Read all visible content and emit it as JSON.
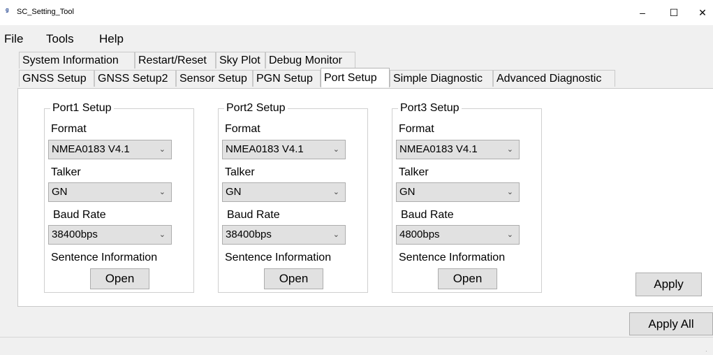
{
  "window": {
    "title": "SC_Setting_Tool",
    "min": "–",
    "max": "☐",
    "close": "✕"
  },
  "menu": [
    "File",
    "Tools",
    "Help"
  ],
  "tabs_row1": [
    "System Information",
    "Restart/Reset",
    "Sky Plot",
    "Debug Monitor"
  ],
  "tabs_row2": [
    "GNSS Setup",
    "GNSS Setup2",
    "Sensor Setup",
    "PGN Setup",
    "Port Setup",
    "Simple Diagnostic",
    "Advanced Diagnostic"
  ],
  "ports": [
    {
      "title": "Port1 Setup",
      "format_label": "Format",
      "format": "NMEA0183 V4.1",
      "talker_label": "Talker",
      "talker": "GN",
      "baud_label": "Baud Rate",
      "baud": "38400bps",
      "sentence_label": "Sentence Information",
      "open": "Open"
    },
    {
      "title": "Port2 Setup",
      "format_label": "Format",
      "format": "NMEA0183 V4.1",
      "talker_label": "Talker",
      "talker": "GN",
      "baud_label": "Baud Rate",
      "baud": "38400bps",
      "sentence_label": "Sentence Information",
      "open": "Open"
    },
    {
      "title": "Port3 Setup",
      "format_label": "Format",
      "format": "NMEA0183 V4.1",
      "talker_label": "Talker",
      "talker": "GN",
      "baud_label": "Baud Rate",
      "baud": "4800bps",
      "sentence_label": "Sentence Information",
      "open": "Open"
    }
  ],
  "apply": "Apply",
  "apply_all": "Apply All",
  "icons": {
    "app": "app-icon",
    "dropdown": "chevron-down-icon",
    "grip": "resize-grip-icon"
  }
}
